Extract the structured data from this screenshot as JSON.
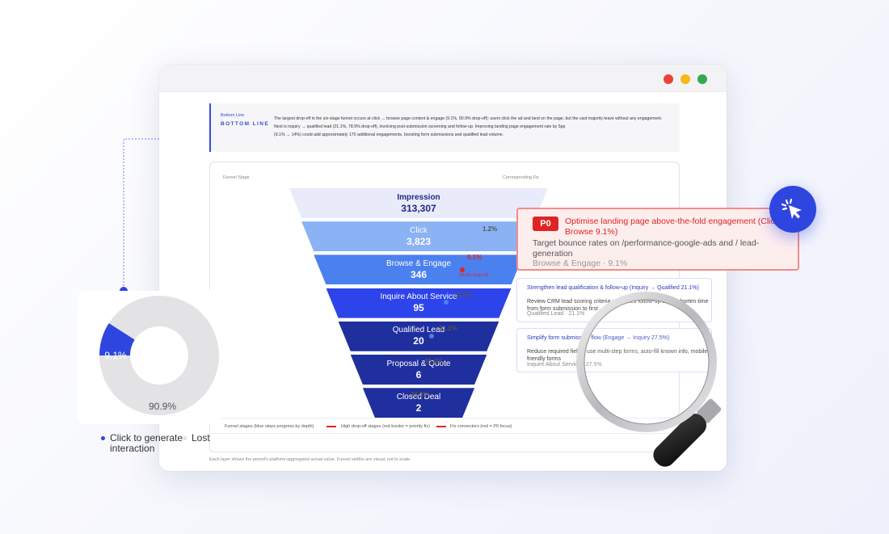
{
  "bottom_line": {
    "label_small": "Bottom Line",
    "label_big": "BOTTOM LINE",
    "line1": "The largest drop-off in the six-stage funnel occurs at click → browse page content & engage (9.1%, 90.9% drop-off): users click the ad and land on the page, but the vast majority leave without any engagement.",
    "line2": "Next is inquiry → qualified lead (21.1%, 78.9% drop-off), involving post-submission screening and follow-up. Improving landing page engagement rate by 5pp",
    "line3": "(9.1% → 14%) could add approximately 170 additional engagements, boosting form submissions and qualified lead volume."
  },
  "funnel_card": {
    "col_stage": "Funnel Stage",
    "col_fix": "Corresponding Fix",
    "stages": [
      {
        "name": "Impression",
        "value": "313,307",
        "color": "#e9ebfb",
        "text": "#1f2a80"
      },
      {
        "name": "Click",
        "value": "3,823",
        "color": "#8ab2f4",
        "text": "#ffffff"
      },
      {
        "name": "Browse & Engage",
        "value": "346",
        "color": "#4b80ef",
        "text": "#ffffff"
      },
      {
        "name": "Inquire About Service",
        "value": "95",
        "color": "#2d44eb",
        "text": "#ffffff"
      },
      {
        "name": "Qualified Lead",
        "value": "20",
        "color": "#1f2f9e",
        "text": "#ffffff"
      },
      {
        "name": "Proposal & Quote",
        "value": "6",
        "color": "#1f2f9e",
        "text": "#ffffff"
      },
      {
        "name": "Closed Deal",
        "value": "2",
        "color": "#1f2f9e",
        "text": "#ffffff"
      }
    ],
    "conversions": [
      "1.2%",
      "9.1%",
      "27.5%",
      "21.1%",
      "30.0%",
      "33.3%"
    ],
    "drop_note": "90.9% drop-off",
    "legend": {
      "stages": "Funnel stages (blue steps progress by depth)",
      "high_dropoff": "High drop-off stages (red border = priority fix)",
      "connectors": "Fix connectors (red = P0 focus)"
    },
    "footnote": "Each layer shows the period's platform-aggregated actual value. Funnel widths are visual, not to scale."
  },
  "fixes": {
    "p0": {
      "badge": "P0",
      "title": "Optimise landing page above-the-fold engagement (Click → Browse 9.1%)",
      "desc": "Target bounce rates on /performance-google-ads and / lead-generation",
      "meta": "Browse & Engage · 9.1%"
    },
    "items": [
      {
        "title": "Strengthen lead qualification & follow-up (Inquiry → Qualified 21.1%)",
        "desc": "Review CRM lead scoring criteria and sales follow-up SOP; shorten time from form submission to first",
        "meta": "Qualified Lead · 21.1%"
      },
      {
        "title": "Simplify form submission flow (Engage → Inquiry 27.5%)",
        "desc": "Reduce required fields, use multi-step forms, auto-fill known info, mobile-friendly forms",
        "meta": "Inquire About Service · 27.5%"
      }
    ]
  },
  "donut": {
    "interaction_pct": 9.1,
    "interaction_label": "9.1%",
    "lost_label": "90.9%",
    "legend_interaction": "Click to generate interaction",
    "legend_lost": "Lost",
    "colors": {
      "interaction": "#2f45e0",
      "lost": "#e3e3e6"
    }
  },
  "icons": {
    "cursor": "cursor-click-icon",
    "magnifier": "magnifying-glass-icon"
  }
}
